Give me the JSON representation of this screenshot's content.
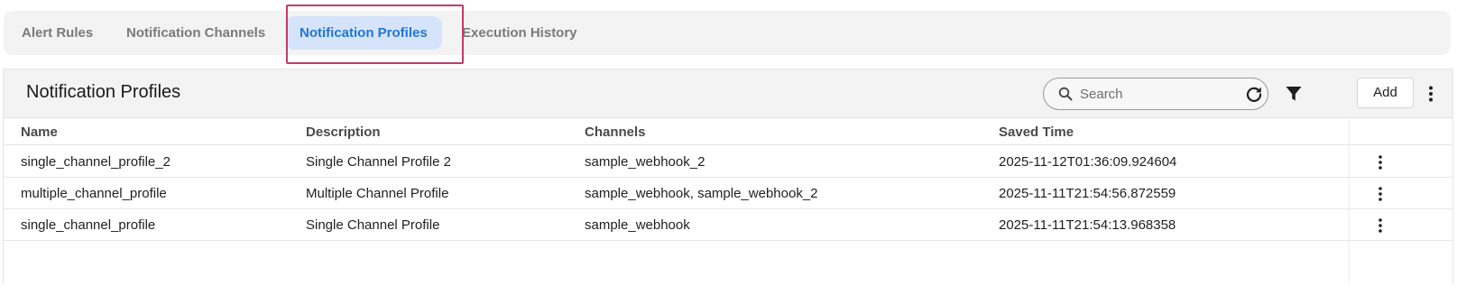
{
  "tabs": [
    {
      "label": "Alert Rules",
      "active": false
    },
    {
      "label": "Notification Channels",
      "active": false
    },
    {
      "label": "Notification Profiles",
      "active": true
    },
    {
      "label": "Execution History",
      "active": false
    }
  ],
  "panel": {
    "title": "Notification Profiles",
    "search_placeholder": "Search",
    "add_label": "Add"
  },
  "table": {
    "columns": [
      "Name",
      "Description",
      "Channels",
      "Saved Time"
    ],
    "rows": [
      [
        "single_channel_profile_2",
        "Single Channel Profile 2",
        "sample_webhook_2",
        "2025-11-12T01:36:09.924604"
      ],
      [
        "multiple_channel_profile",
        "Multiple Channel Profile",
        "sample_webhook, sample_webhook_2",
        "2025-11-11T21:54:56.872559"
      ],
      [
        "single_channel_profile",
        "Single Channel Profile",
        "sample_webhook",
        "2025-11-11T21:54:13.968358"
      ]
    ]
  },
  "colors": {
    "accent": "#2276d2",
    "active_tab_bg": "#d6e4fb",
    "highlight_border": "#c43b68"
  },
  "icons": [
    "search-icon",
    "refresh-icon",
    "filter-icon",
    "more-vertical-icon"
  ]
}
